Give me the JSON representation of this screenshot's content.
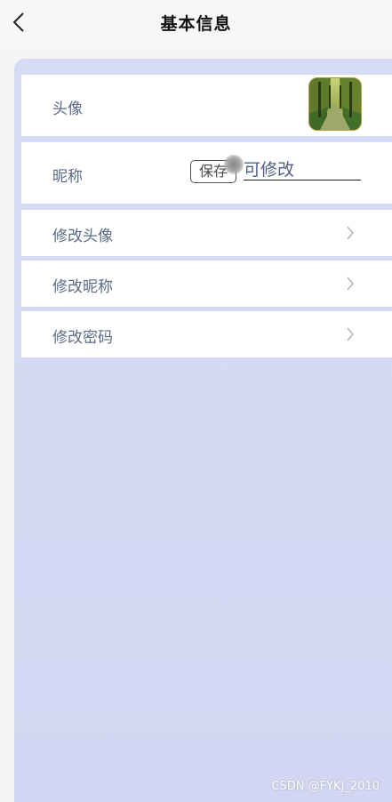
{
  "header": {
    "title": "基本信息",
    "back_icon": "chevron-left-icon"
  },
  "profile": {
    "avatar_label": "头像",
    "avatar_image": "tree-lined-road-thumbnail",
    "nickname_label": "昵称",
    "save_label": "保存",
    "nickname_value": "可修改"
  },
  "menu": {
    "items": [
      {
        "label": "修改头像",
        "icon": "chevron-right-icon"
      },
      {
        "label": "修改昵称",
        "icon": "chevron-right-icon"
      },
      {
        "label": "修改密码",
        "icon": "chevron-right-icon"
      }
    ]
  },
  "watermark": "CSDN @FYKJ_2010",
  "colors": {
    "panel_background": "#d6dbf5",
    "label_text": "#5a6b86",
    "input_text": "#4d5f8a"
  }
}
